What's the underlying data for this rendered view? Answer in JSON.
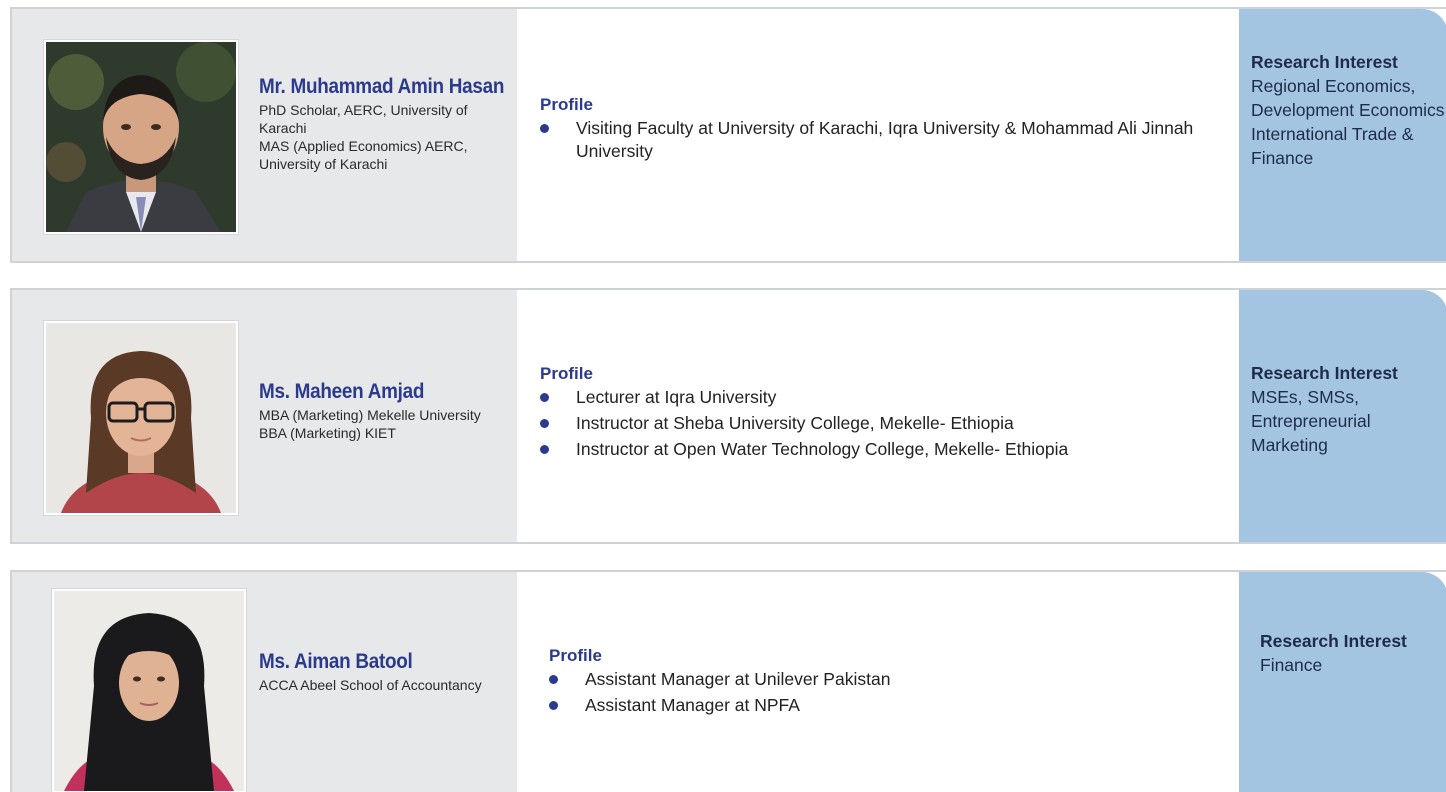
{
  "people": [
    {
      "name": "Mr. Muhammad Amin Hasan",
      "credentials": "PhD Scholar, AERC, University of Karachi\nMAS (Applied Economics) AERC, University of Karachi",
      "profile_title": "Profile",
      "profile_items": [
        "Visiting Faculty at University of Karachi, Iqra University & Mohammad Ali Jinnah University"
      ],
      "research_title": "Research Interest",
      "research_text": "Regional Economics, Development Economics, International Trade & Finance"
    },
    {
      "name": "Ms. Maheen Amjad",
      "credentials": "MBA (Marketing) Mekelle University\nBBA (Marketing) KIET",
      "profile_title": "Profile",
      "profile_items": [
        "Lecturer at Iqra University",
        "Instructor at Sheba University College, Mekelle- Ethiopia",
        "Instructor at Open Water Technology College, Mekelle- Ethiopia"
      ],
      "research_title": "Research Interest",
      "research_text": "MSEs, SMSs, Entrepreneurial Marketing"
    },
    {
      "name": "Ms. Aiman Batool",
      "credentials": "ACCA Abeel School of Accountancy",
      "profile_title": "Profile",
      "profile_items": [
        "Assistant Manager at Unilever Pakistan",
        "Assistant Manager at NPFA"
      ],
      "research_title": "Research Interest",
      "research_text": "Finance"
    }
  ],
  "colors": {
    "name_blue": "#2b3a8c",
    "left_panel_gray": "#e7e8ea",
    "research_panel_blue": "#a3c5e2"
  },
  "icons": {
    "bullet": "filled-circle-icon"
  }
}
